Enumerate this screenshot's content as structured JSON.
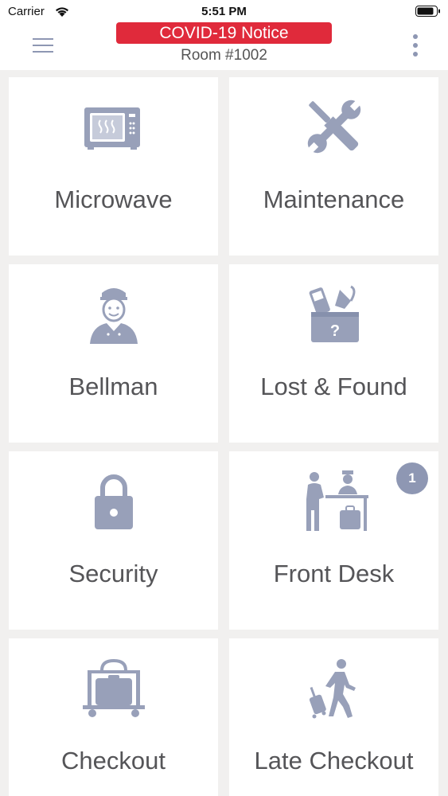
{
  "status_bar": {
    "carrier": "Carrier",
    "time": "5:51 PM"
  },
  "header": {
    "notice_label": "COVID-19 Notice",
    "room": "Room #1002",
    "notice_color": "#e02a3b"
  },
  "tiles": [
    {
      "label": "Microwave",
      "icon": "microwave-icon"
    },
    {
      "label": "Maintenance",
      "icon": "tools-icon"
    },
    {
      "label": "Bellman",
      "icon": "bellman-icon"
    },
    {
      "label": "Lost & Found",
      "icon": "lost-found-box-icon"
    },
    {
      "label": "Security",
      "icon": "padlock-icon"
    },
    {
      "label": "Front Desk",
      "icon": "front-desk-icon",
      "badge": "1"
    },
    {
      "label": "Checkout",
      "icon": "luggage-cart-icon"
    },
    {
      "label": "Late Checkout",
      "icon": "walking-traveler-icon"
    }
  ],
  "colors": {
    "icon": "#98a0b9",
    "background": "#f1f0ef",
    "badge": "#8e97b3"
  }
}
